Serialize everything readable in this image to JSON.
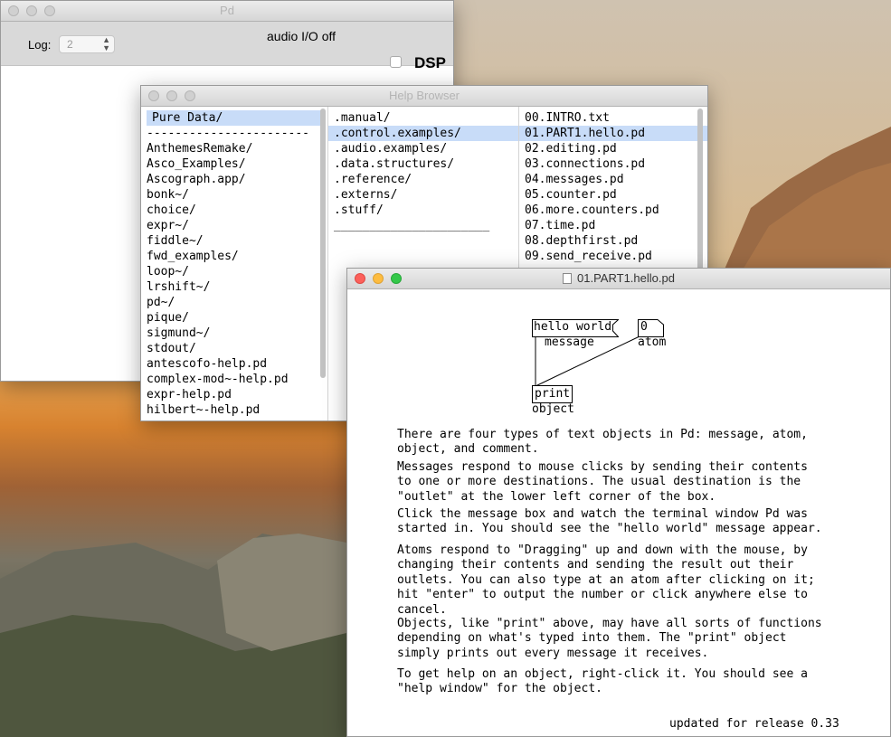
{
  "pd_window": {
    "title": "Pd",
    "log_label": "Log:",
    "log_value": "2",
    "audio_status": "audio I/O off",
    "dsp_label": "DSP"
  },
  "help_browser": {
    "title": "Help Browser",
    "col1": [
      "Pure Data/",
      "-----------------------",
      "AnthemesRemake/",
      "Asco_Examples/",
      "Ascograph.app/",
      "bonk~/",
      "choice/",
      "expr~/",
      "fiddle~/",
      "fwd_examples/",
      "loop~/",
      "lrshift~/",
      "pd~/",
      "pique/",
      "sigmund~/",
      "stdout/",
      "antescofo-help.pd",
      "complex-mod~-help.pd",
      "expr-help.pd",
      "hilbert~-help.pd"
    ],
    "col2": [
      ".manual/",
      ".control.examples/",
      ".audio.examples/",
      ".data.structures/",
      ".reference/",
      ".externs/",
      ".stuff/",
      "______________________"
    ],
    "col3": [
      "00.INTRO.txt",
      "01.PART1.hello.pd",
      "02.editing.pd",
      "03.connections.pd",
      "04.messages.pd",
      "05.counter.pd",
      "06.more.counters.pd",
      "07.time.pd",
      "08.depthfirst.pd",
      "09.send_receive.pd"
    ]
  },
  "patch": {
    "title": "01.PART1.hello.pd",
    "message_box": "hello world",
    "message_caption": "message",
    "atom_box": "0",
    "atom_caption": "atom",
    "object_box": "print",
    "object_caption": "object",
    "paragraphs": [
      "There are four types of text objects in Pd: message, atom,\nobject, and comment.",
      "Messages respond to mouse clicks by sending their contents\nto one or more destinations. The usual destination is the\n\"outlet\" at the lower left corner of the box.",
      "Click the message box and watch the terminal window Pd was\nstarted in. You should see the \"hello world\" message appear.",
      "Atoms respond to \"Dragging\" up and down with the mouse, by\nchanging their contents and sending the result out their\noutlets. You can also type at an atom after clicking on it;\nhit \"enter\" to output the number or click anywhere else to\ncancel.",
      "Objects, like \"print\" above, may have all sorts of functions\ndepending on what's typed into them. The \"print\" object\nsimply prints out every message it receives.",
      "To get help on an object, right-click it. You should see a\n\"help window\" for the object."
    ],
    "footer": "updated for release 0.33"
  }
}
